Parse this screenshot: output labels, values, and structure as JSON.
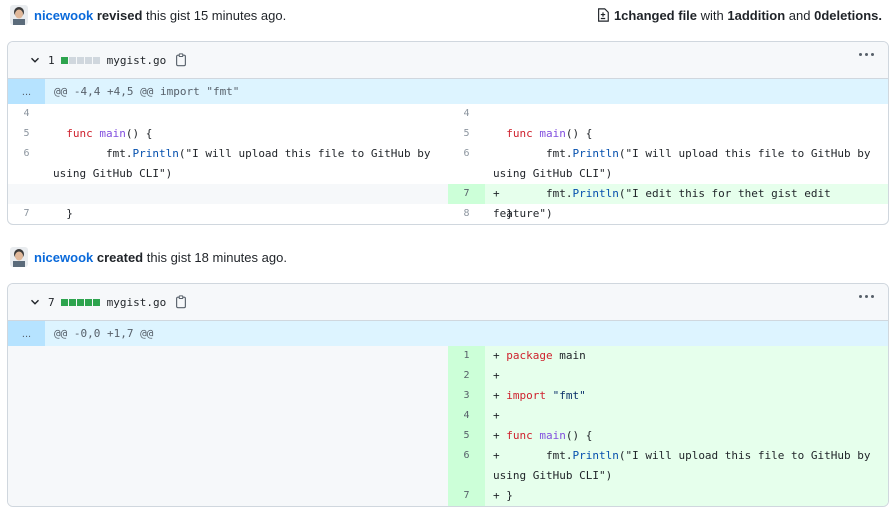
{
  "revisions": [
    {
      "user": "nicewook",
      "verb": "revised",
      "rest": " this gist 15 minutes ago.",
      "stats": {
        "changed_count": "1",
        "changed_label": " changed file",
        "with": " with ",
        "additions": "1",
        "additions_label": " addition",
        "and": " and ",
        "deletions": "0",
        "deletions_label": " deletions."
      },
      "file": {
        "count": "1",
        "name": "mygist.go",
        "hunk_expand": "...",
        "hunk": "@@ -4,4 +4,5 @@ import \"fmt\""
      }
    },
    {
      "user": "nicewook",
      "verb": "created",
      "rest": " this gist 18 minutes ago.",
      "file": {
        "count": "7",
        "name": "mygist.go",
        "hunk_expand": "...",
        "hunk": "@@ -0,0 +1,7 @@"
      }
    }
  ],
  "diff1": {
    "left": [
      {
        "n": "4",
        "code": ""
      },
      {
        "n": "5",
        "code": "  func main() {"
      },
      {
        "n": "6",
        "code": "        fmt.Println(\"I will upload this file to GitHub by using GitHub CLI\")"
      },
      {
        "n": "",
        "code": ""
      },
      {
        "n": "7",
        "code": "  }"
      }
    ],
    "right": [
      {
        "n": "4",
        "code": ""
      },
      {
        "n": "5",
        "code": "  func main() {"
      },
      {
        "n": "6",
        "code": "        fmt.Println(\"I will upload this file to GitHub by using GitHub CLI\")"
      },
      {
        "n": "7",
        "code": "+       fmt.Println(\"I edit this for thet gist edit feature\")"
      },
      {
        "n": "8",
        "code": "  }"
      }
    ]
  },
  "diff2": {
    "right": [
      {
        "n": "1",
        "code": "+ package main"
      },
      {
        "n": "2",
        "code": "+"
      },
      {
        "n": "3",
        "code": "+ import \"fmt\""
      },
      {
        "n": "4",
        "code": "+"
      },
      {
        "n": "5",
        "code": "+ func main() {"
      },
      {
        "n": "6",
        "code": "+       fmt.Println(\"I will upload this file to GitHub by using GitHub CLI\")"
      },
      {
        "n": "7",
        "code": "+ }"
      }
    ]
  },
  "colors": {
    "link": "#0969da",
    "added_bg": "#e6ffec",
    "added_num_bg": "#ccffd8",
    "hunk_bg": "#ddf4ff"
  }
}
